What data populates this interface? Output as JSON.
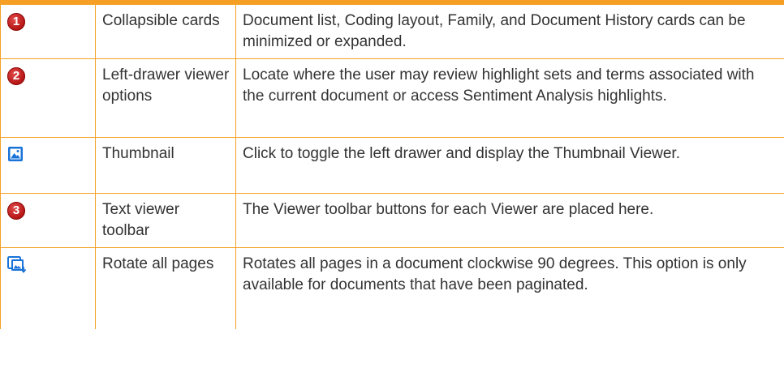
{
  "rows": [
    {
      "icon": "number-1-icon",
      "badge": "1",
      "name": "Collapsible cards",
      "description": "Document list, Coding layout, Family, and Document History cards can be minimized or expanded."
    },
    {
      "icon": "number-2-icon",
      "badge": "2",
      "name": "Left-drawer viewer options",
      "description": "Locate where the user may review highlight sets and terms associated with the current document or access Sentiment Analysis highlights."
    },
    {
      "icon": "thumbnail-icon",
      "name": "Thumbnail",
      "description": "Click to toggle the left drawer and display the Thumbnail Viewer."
    },
    {
      "icon": "number-3-icon",
      "badge": "3",
      "name": "Text viewer toolbar",
      "description": "The Viewer toolbar buttons for each Viewer are placed here."
    },
    {
      "icon": "rotate-all-pages-icon",
      "name": "Rotate all pages",
      "description": "Rotates all pages in a document clockwise 90 degrees. This option is only available for documents that have been paginated."
    }
  ],
  "colors": {
    "border": "#f5a025",
    "badge": "#c41a1a",
    "icon_blue": "#1a73d9"
  }
}
